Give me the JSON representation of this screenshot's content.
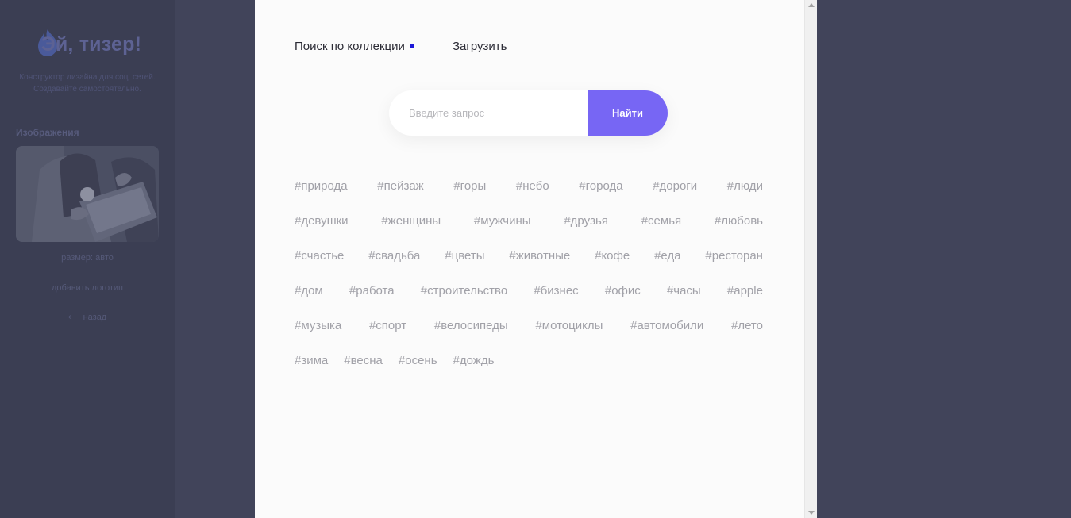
{
  "sidebar": {
    "logo_text": "Эй, тизер!",
    "tagline_line1": "Конструктор дизайна для соц. сетей.",
    "tagline_line2": "Создавайте самостоятельно.",
    "section_title": "Изображения",
    "size_label": "размер: авто",
    "add_logo_label": "добавить логотип",
    "back_label": "⟵ назад"
  },
  "modal": {
    "tabs": [
      {
        "label": "Поиск по коллекции",
        "active": true
      },
      {
        "label": "Загрузить",
        "active": false
      }
    ],
    "search": {
      "placeholder": "Введите запрос",
      "value": "",
      "button_label": "Найти"
    },
    "tag_rows": [
      [
        "#природа",
        "#пейзаж",
        "#горы",
        "#небо",
        "#города",
        "#дороги",
        "#люди"
      ],
      [
        "#девушки",
        "#женщины",
        "#мужчины",
        "#друзья",
        "#семья",
        "#любовь"
      ],
      [
        "#счастье",
        "#свадьба",
        "#цветы",
        "#животные",
        "#кофе",
        "#еда",
        "#ресторан"
      ],
      [
        "#дом",
        "#работа",
        "#строительство",
        "#бизнес",
        "#офис",
        "#часы",
        "#apple"
      ],
      [
        "#музыка",
        "#спорт",
        "#велосипеды",
        "#мотоциклы",
        "#автомобили",
        "#лето"
      ],
      [
        "#зима",
        "#весна",
        "#осень",
        "#дождь"
      ]
    ]
  },
  "colors": {
    "accent": "#7766f4",
    "active_dot": "#1c18d8",
    "overlay": "#41445a",
    "panel_bg": "#fbfbfb",
    "tag_text": "#a1a1a8"
  }
}
